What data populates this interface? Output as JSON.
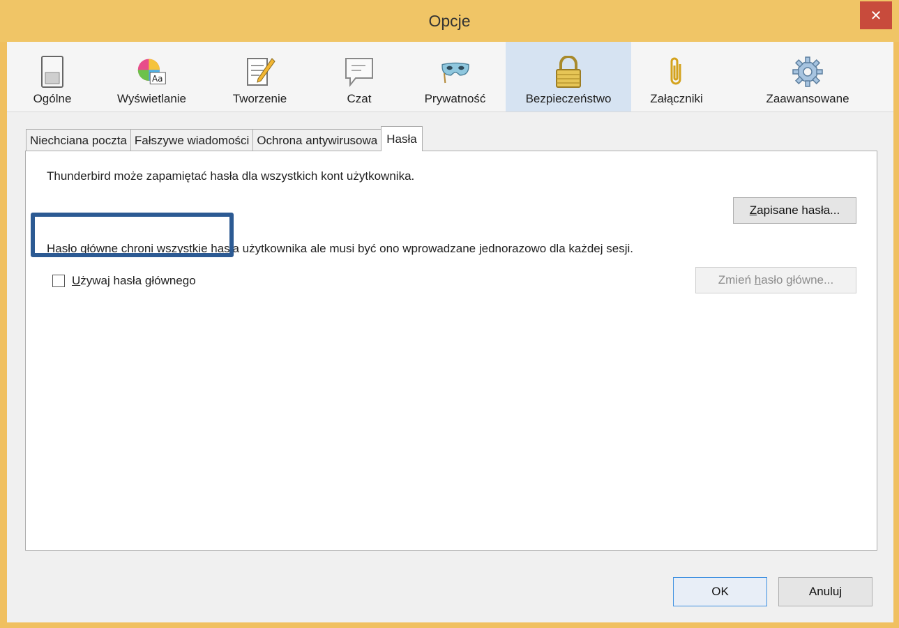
{
  "window": {
    "title": "Opcje",
    "close_glyph": "✕"
  },
  "panes": [
    {
      "label": "Ogólne",
      "icon": "general-switch-icon"
    },
    {
      "label": "Wyświetlanie",
      "icon": "display-palette-icon"
    },
    {
      "label": "Tworzenie",
      "icon": "compose-pencil-icon"
    },
    {
      "label": "Czat",
      "icon": "chat-bubble-icon"
    },
    {
      "label": "Prywatność",
      "icon": "privacy-mask-icon"
    },
    {
      "label": "Bezpieczeństwo",
      "icon": "security-padlock-icon",
      "selected": true
    },
    {
      "label": "Załączniki",
      "icon": "attachment-paperclip-icon"
    },
    {
      "label": "Zaawansowane",
      "icon": "advanced-gear-icon"
    }
  ],
  "subtabs": [
    {
      "label": "Niechciana poczta"
    },
    {
      "label": "Fałszywe wiadomości"
    },
    {
      "label": "Ochrona antywirusowa"
    },
    {
      "label": "Hasła",
      "selected": true
    }
  ],
  "passwords": {
    "intro": "Thunderbird może zapamiętać hasła dla wszystkich kont użytkownika.",
    "saved_btn_key": "Z",
    "saved_btn_rest": "apisane hasła...",
    "master_desc": "Hasło główne chroni wszystkie hasła użytkownika ale musi być ono wprowadzane jednorazowo dla każdej sesji.",
    "use_master_key": "U",
    "use_master_rest": "żywaj hasła głównego",
    "use_master_checked": false,
    "change_btn_pre": "Zmień ",
    "change_btn_key": "h",
    "change_btn_post": "asło główne...",
    "change_btn_enabled": false
  },
  "footer": {
    "ok": "OK",
    "cancel": "Anuluj"
  },
  "colors": {
    "titlebar": "#f0c566",
    "close": "#c84b3c",
    "selected_pane": "#d6e3f2",
    "highlight_box": "#2c5a93"
  }
}
